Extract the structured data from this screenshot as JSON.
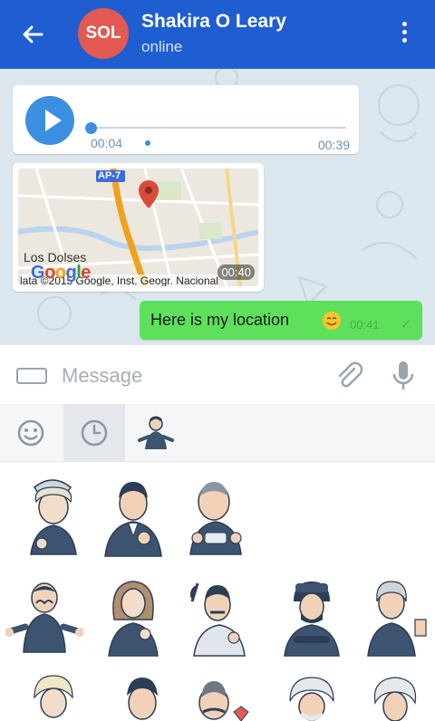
{
  "header": {
    "avatar_initials": "SOL",
    "contact_name": "Shakira O Leary",
    "status": "online",
    "accent_color": "#1f5ed1"
  },
  "messages": {
    "voice": {
      "elapsed": "00:04",
      "duration": "00:39"
    },
    "location": {
      "place": "Los Dolses",
      "road_label": "AP-7",
      "attribution": "lata ©2015 Google, Inst. Geogr. Nacional",
      "time": "00:40"
    },
    "outgoing": {
      "text": "Here is my location",
      "time": "00:41"
    }
  },
  "input": {
    "placeholder": "Message"
  },
  "sticker_tabs": [
    {
      "icon": "emoji-icon"
    },
    {
      "icon": "recent-clock-icon"
    },
    {
      "icon": "sticker-pack-thumbnail"
    }
  ]
}
